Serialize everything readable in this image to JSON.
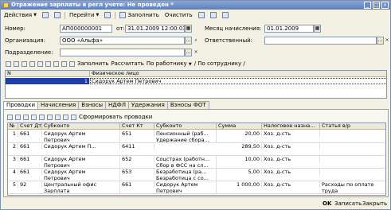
{
  "window": {
    "title": "Отражение зарплаты в регл учете: Не проведен *",
    "controls": [
      "_",
      "□",
      "×"
    ]
  },
  "toolbar": {
    "actions": "Действия",
    "goto": "Перейти",
    "fill": "Заполнить",
    "clear": "Очистить"
  },
  "form": {
    "number_label": "Номер:",
    "number_value": "АП000000001",
    "date_label": "от:",
    "date_value": "31.01.2009 12:00:03",
    "month_label": "Месяц начисления:",
    "month_value": "01.01.2009",
    "org_label": "Организация:",
    "org_value": "ООО «Альфа»",
    "responsible_label": "Ответственный:",
    "responsible_value": "",
    "dept_label": "Подразделение:",
    "dept_value": ""
  },
  "employees_toolbar": {
    "fill": "Заполнить",
    "calculate": "Рассчитать",
    "by_employee": "По работнику",
    "by_employee_suffix": "/ По сотруднику /"
  },
  "employees_table": {
    "headers": [
      "N",
      "Физическое лицо"
    ],
    "rows": [
      {
        "n": "1",
        "person": "Сидорук Артем Петрович"
      }
    ]
  },
  "tabs": [
    "Проводки",
    "Начисления",
    "Взносы",
    "НДФЛ",
    "Удержания",
    "Взносы ФОТ"
  ],
  "entries_toolbar": {
    "generate": "Сформировать проводки"
  },
  "entries_table": {
    "headers": [
      "№",
      "Счет Дт",
      "Субконто",
      "Счет Кт",
      "Субконто",
      "Сумма",
      "Налоговое назна...",
      "Статья в/р"
    ],
    "rows": [
      {
        "n": "1",
        "dt": "661",
        "sub_dt": [
          "Сидорук Артем",
          "Петрович"
        ],
        "kt": "651",
        "sub_kt": [
          "Пенсионный (раб...",
          "Удержание сборa..."
        ],
        "sum": "20,00",
        "tax": "Хоз. д-сть",
        "art": [
          ""
        ]
      },
      {
        "n": "2",
        "dt": "661",
        "sub_dt": [
          "Сидорук Артем П..."
        ],
        "kt": "6411",
        "sub_kt": [
          ""
        ],
        "sum": "289,50",
        "tax": "Хоз. д-сть",
        "art": [
          ""
        ]
      },
      {
        "n": "3",
        "dt": "661",
        "sub_dt": [
          "Сидорук Артем",
          "Петрович"
        ],
        "kt": "652",
        "sub_kt": [
          "Соцстрах (работн...",
          "Сбор в ФСС на сл..."
        ],
        "sum": "10,00",
        "tax": "Хоз. д-сть",
        "art": [
          ""
        ]
      },
      {
        "n": "4",
        "dt": "661",
        "sub_dt": [
          "Сидорук Артем",
          "Петрович"
        ],
        "kt": "653",
        "sub_kt": [
          "Безработица (ра...",
          "Безработица с со..."
        ],
        "sum": "5,00",
        "tax": "Хоз. д-сть",
        "art": [
          ""
        ]
      },
      {
        "n": "5",
        "dt": "92",
        "sub_dt": [
          "Центральный офис",
          "Зарплата"
        ],
        "kt": "661",
        "sub_kt": [
          "Сидорук Артем",
          "Петрович"
        ],
        "sum": "1 000,00",
        "tax": "Хоз. д-сть",
        "art": [
          "Расходы по оплате",
          "труда"
        ]
      }
    ]
  },
  "footer": {
    "ok": "OK",
    "save": "Записать",
    "close": "Закрыть"
  },
  "colors": {
    "title_bar": "#5b7fbf",
    "window_bg": "#f3f1e4",
    "selection": "#1f3fa6"
  }
}
